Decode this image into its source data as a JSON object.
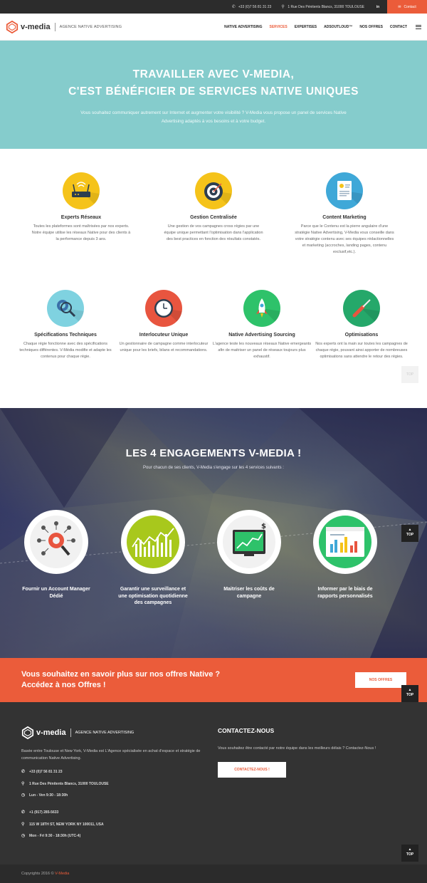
{
  "topbar": {
    "phone": "+33 (0)7 56 81 31 23",
    "address": "1 Rue Des Pénitents Blancs, 31000 TOULOUSE",
    "linkedin": "in",
    "contact_label": "Contact"
  },
  "header": {
    "brand": "v-media",
    "tagline": "AGENCE NATIVE ADVERTISING",
    "menu": [
      {
        "label": "NATIVE ADVERTISING"
      },
      {
        "label": "SERVICES"
      },
      {
        "label": "EXPERTISES"
      },
      {
        "label": "ADSOUTLOUD™"
      },
      {
        "label": "NOS OFFRES"
      },
      {
        "label": "CONTACT"
      }
    ]
  },
  "hero": {
    "title_line1": "TRAVAILLER AVEC V-MEDIA,",
    "title_line2": "C'EST BÉNÉFICIER DE SERVICES NATIVE UNIQUES",
    "text": "Vous souhaitez communiquer autrement sur Internet et augmenter votre visibilité ? V-Media vous propose un panel de services Native Advertising adaptés à vos besoins et à votre budget."
  },
  "services": [
    {
      "title": "Experts Réseaux",
      "text": "Toutes les plateformes sont maîtrisées par nos experts. Notre équipe utilise les réseaux Native pour des clients à la performance depuis 3 ans.",
      "icon": "router-icon",
      "color": "#f5c31a"
    },
    {
      "title": "Gestion Centralisée",
      "text": "Une gestion de vos campagnes cross régies par une équipe unique permettant l'optimisation dans l'application des best practices en fonction des résultats constatés.",
      "icon": "target-icon",
      "color": "#f5c31a"
    },
    {
      "title": "Content Marketing",
      "text": "Parce que le Contenu est la pierre angulaire d'une stratégie Native Advertising, V-Media vous conseille dans votre stratégie contenu avec ses équipes rédactionnelles et marketing (accroches, landing pages, contenu exclusif,etc.).",
      "icon": "document-chart-icon",
      "color": "#3fa8d8"
    },
    {
      "title": "Spécifications Techniques",
      "text": "Chaque régie fonctionne avec des spécifications techniques différentes. V-Média modifie et adapte les contenus pour chaque régie.",
      "icon": "magnifier-gear-icon",
      "color": "#7fd2e0"
    },
    {
      "title": "Interlocuteur Unique",
      "text": "Un gestionnaire de campagne comme interlocuteur unique pour les briefs, bilans et recommandations.",
      "icon": "clock-icon",
      "color": "#e8553f"
    },
    {
      "title": "Native Advertising Sourcing",
      "text": "L'agence teste les nouveaux réseaux Native emergeants afin de maitriser un panel de réseaux toujours plus exhaustif.",
      "icon": "rocket-icon",
      "color": "#2ec26a"
    },
    {
      "title": "Optimisations",
      "text": "Nos experts ont la main sur toutes les campagnes de chaque régie, pouvant ainsi apporter de nombreuses optimisations sans attendre le retour des régies.",
      "icon": "screwdriver-icon",
      "color": "#25a86a"
    }
  ],
  "engagements": {
    "title": "LES 4 ENGAGEMENTS V-MEDIA !",
    "subtitle": "Pour chacun de ses clients, V-Media s'engage sur les 4 services suivants :",
    "items": [
      {
        "label": "Fournir un Account Manager Dédié",
        "icon": "account-manager-icon"
      },
      {
        "label": "Garantir une surveillance et une optimisation quotidienne des campagnes",
        "icon": "monitoring-chart-icon"
      },
      {
        "label": "Maitriser les coûts de campagne",
        "icon": "cost-monitor-icon"
      },
      {
        "label": "Informer par le biais de rapports personnalisés",
        "icon": "report-dashboard-icon"
      }
    ]
  },
  "top_label": "TOP",
  "cta": {
    "line1": "Vous souhaitez en savoir plus sur nos offres Native ?",
    "line2": "Accédez à nos Offres !",
    "button": "NOS OFFRES"
  },
  "footer": {
    "brand": "v-media",
    "tagline": "AGENCE NATIVE ADVERTISING",
    "description": "Basée entre Toulouse et New York, V-Media est L'Agence spécialisée en achat d'espace et stratégie de communication Native Advertising.",
    "fr_phone": "+33 (0)7 56 81 31 23",
    "fr_address": "1 Rue Des Pénitents Blancs, 31000 TOULOUSE",
    "fr_hours": "Lun - Ven 9:30 - 18:30h",
    "us_phone": "+1 (917) 285-5633",
    "us_address": "115 W 18TH ST, NEW YORK NY 100011, USA",
    "us_hours": "Mon - Fri 9:30 - 18:30h (UTC-4)",
    "contact_title": "CONTACTEZ-NOUS",
    "contact_text": "Vous souhaitez être contacté par notre équipe dans les meilleurs délais ? Contactez-Nous !",
    "contact_button": "CONTACTEZ-NOUS !",
    "copyright_prefix": "Copyrights 2016 ©",
    "copyright_brand": "V-Media"
  },
  "colors": {
    "accent": "#eb5c3a",
    "hero": "#85cccc",
    "dark": "#333333"
  }
}
